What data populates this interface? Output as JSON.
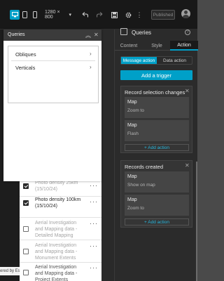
{
  "toolbar": {
    "resolution": "1280 × 800",
    "published_label": "Published",
    "icons": [
      "desktop-icon",
      "tablet-icon",
      "phone-icon",
      "undo-icon",
      "redo-icon",
      "save-icon",
      "settings-icon",
      "more-icon"
    ]
  },
  "canvas": {
    "list": [
      {
        "text": "Photo density 25km (15/10/24)",
        "checked": true,
        "dimmed": false
      },
      {
        "text": "Photo density 100km (15/10/24)",
        "checked": true,
        "dimmed": false
      },
      {
        "text": "Aerial Investigation and Mapping data - Detailed Mapping",
        "checked": false,
        "dimmed": true
      },
      {
        "text": "Aerial Investigation and Mapping data - Monument Extents",
        "checked": false,
        "dimmed": true
      },
      {
        "text": "Aerial Investigation and Mapping data - Project Extents",
        "checked": false,
        "dimmed": false
      }
    ],
    "credit": "ered by Esri"
  },
  "popup": {
    "title": "Queries",
    "items": [
      {
        "label": "Obliques"
      },
      {
        "label": "Verticals"
      }
    ]
  },
  "panel": {
    "title": "Queries",
    "tabs": [
      {
        "label": "Content",
        "active": false
      },
      {
        "label": "Style",
        "active": false
      },
      {
        "label": "Action",
        "active": true
      }
    ],
    "segments": [
      {
        "label": "Message action",
        "active": true
      },
      {
        "label": "Data action",
        "active": false
      }
    ],
    "add_trigger_label": "Add a trigger",
    "cards": [
      {
        "title": "Record selection changes",
        "actions": [
          {
            "title": "Map",
            "sub": "Zoom to"
          },
          {
            "title": "Map",
            "sub": "Flash"
          }
        ],
        "add_label": "+ Add action"
      },
      {
        "title": "Records created",
        "actions": [
          {
            "title": "Map",
            "sub": "Show on map"
          },
          {
            "title": "Map",
            "sub": "Zoom to"
          }
        ],
        "add_label": "+ Add action"
      }
    ]
  },
  "colors": {
    "accent": "#00a0c8",
    "panel_bg": "#2b2b2b",
    "toolbar_bg": "#181818"
  }
}
